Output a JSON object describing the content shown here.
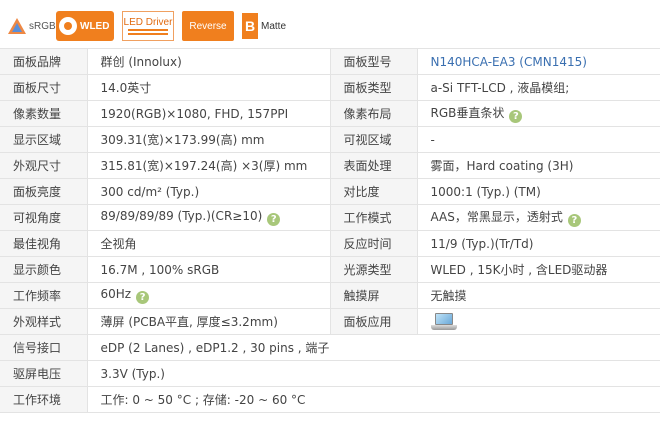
{
  "badges": {
    "srgb": "sRGB",
    "wled": "WLED",
    "led_driver": "LED Driver",
    "reverse": "Reverse",
    "matte_letter": "B",
    "matte": "Matte"
  },
  "specs": {
    "r1": {
      "l1": "面板品牌",
      "v1": "群创 (Innolux)",
      "l2": "面板型号",
      "v2": "N140HCA-EA3 (CMN1415)"
    },
    "r2": {
      "l1": "面板尺寸",
      "v1": "14.0英寸",
      "l2": "面板类型",
      "v2": "a-Si TFT-LCD , 液晶模组;"
    },
    "r3": {
      "l1": "像素数量",
      "v1": "1920(RGB)×1080, FHD, 157PPI",
      "l2": "像素布局",
      "v2": "RGB垂直条状"
    },
    "r4": {
      "l1": "显示区域",
      "v1": "309.31(宽)×173.99(高) mm",
      "l2": "可视区域",
      "v2": "-"
    },
    "r5": {
      "l1": "外观尺寸",
      "v1": "315.81(宽)×197.24(高) ×3(厚) mm",
      "l2": "表面处理",
      "v2": "雾面，Hard coating (3H)"
    },
    "r6": {
      "l1": "面板亮度",
      "v1": "300 cd/m² (Typ.)",
      "l2": "对比度",
      "v2": "1000:1 (Typ.) (TM)"
    },
    "r7": {
      "l1": "可视角度",
      "v1": "89/89/89/89 (Typ.)(CR≥10)",
      "l2": "工作模式",
      "v2": "AAS，常黑显示，透射式"
    },
    "r8": {
      "l1": "最佳视角",
      "v1": "全视角",
      "l2": "反应时间",
      "v2": "11/9 (Typ.)(Tr/Td)"
    },
    "r9": {
      "l1": "显示颜色",
      "v1": "16.7M , 100% sRGB",
      "l2": "光源类型",
      "v2": "WLED , 15K小时 , 含LED驱动器"
    },
    "r10": {
      "l1": "工作频率",
      "v1": "60Hz",
      "l2": "触摸屏",
      "v2": "无触摸"
    },
    "r11": {
      "l1": "外观样式",
      "v1": "薄屏 (PCBA平直, 厚度≤3.2mm)",
      "l2": "面板应用",
      "v2": ""
    },
    "r12": {
      "l1": "信号接口",
      "v1": "eDP (2 Lanes) , eDP1.2 , 30 pins , 端子"
    },
    "r13": {
      "l1": "驱屏电压",
      "v1": "3.3V (Typ.)"
    },
    "r14": {
      "l1": "工作环境",
      "v1": "工作: 0 ~ 50 °C ; 存储: -20 ~ 60 °C"
    }
  },
  "help_glyph": "?",
  "icons": {
    "help": "question-circle-icon",
    "laptop": "laptop-icon"
  },
  "colors": {
    "accent": "#f07f1e",
    "link": "#3a6fb0",
    "label_bg": "#f5f5f5",
    "help": "#a8c77a"
  }
}
